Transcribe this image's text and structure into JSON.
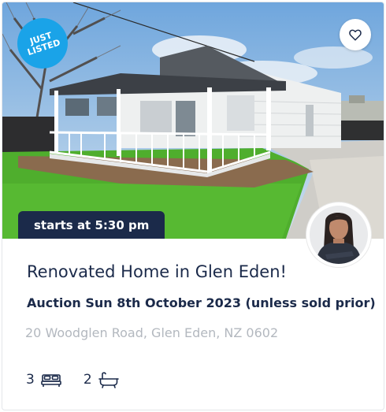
{
  "listing": {
    "badge": "JUST\nLISTED",
    "time_label": "starts at 5:30 pm",
    "title": "Renovated Home in Glen Eden!",
    "auction_line": "Auction Sun 8th October 2023 (unless sold prior)",
    "address": "20 Woodglen Road, Glen Eden, NZ 0602",
    "bedrooms": "3",
    "bathrooms": "2"
  },
  "icons": {
    "favorite": "heart-outline-icon",
    "bedrooms": "bed-icon",
    "bathrooms": "bath-icon"
  },
  "colors": {
    "badge": "#1aa3e8",
    "navy": "#1b2a4a",
    "address": "#b3b8bf"
  }
}
